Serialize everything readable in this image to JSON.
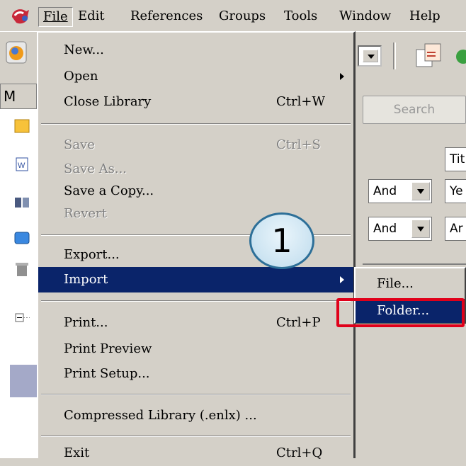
{
  "menubar": {
    "items": [
      "File",
      "Edit",
      "References",
      "Groups",
      "Tools",
      "Window",
      "Help"
    ]
  },
  "background": {
    "left_tab": "M",
    "search_button": "Search",
    "search_rows": [
      {
        "op": "",
        "field": "Tit"
      },
      {
        "op": "And",
        "field": "Ye"
      },
      {
        "op": "And",
        "field": "Ar"
      }
    ]
  },
  "file_menu": {
    "new": "New...",
    "open": "Open",
    "close_library": {
      "label": "Close Library",
      "shortcut": "Ctrl+W"
    },
    "save": {
      "label": "Save",
      "shortcut": "Ctrl+S"
    },
    "save_as": "Save As...",
    "save_copy": "Save a Copy...",
    "revert": "Revert",
    "export": "Export...",
    "import": "Import",
    "print": {
      "label": "Print...",
      "shortcut": "Ctrl+P"
    },
    "print_preview": "Print Preview",
    "print_setup": "Print Setup...",
    "compressed_library": "Compressed Library (.enlx) ...",
    "exit": {
      "label": "Exit",
      "shortcut": "Ctrl+Q"
    }
  },
  "import_submenu": {
    "file": "File...",
    "folder": "Folder..."
  },
  "callout": {
    "number": "1"
  },
  "colors": {
    "menu_bg": "#d4d0c8",
    "highlight": "#0a246a",
    "annotation_red": "#e0001a",
    "callout_border": "#2d6f98"
  }
}
